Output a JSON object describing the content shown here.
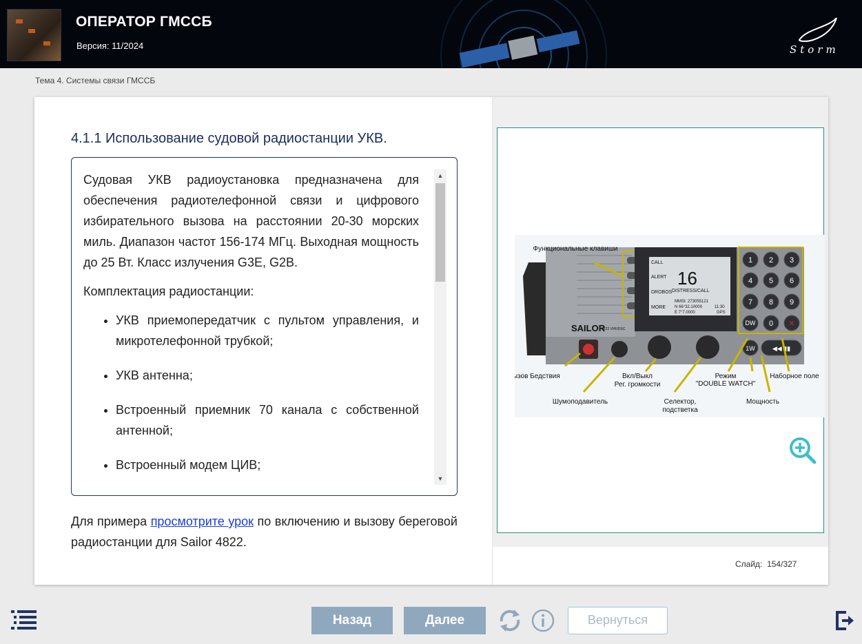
{
  "header": {
    "title": "ОПЕРАТОР ГМССБ",
    "version": "Версия: 11/2024",
    "logo_text": "Storm"
  },
  "breadcrumb": "Тема 4. Системы связи ГМССБ",
  "content": {
    "heading": "4.1.1 Использование судовой радиостанции УКВ.",
    "paragraph1": "Судовая УКВ радиоустановка предназначена для обеспечения радиотелефонной связи и цифрового избирательного вызова на расстоянии 20-30 морских миль. Диапазон частот 156-174 МГц. Выходная мощность до 25 Вт. Класс излучения G3E, G2B.",
    "paragraph2": "Комплектация радиостанции:",
    "list": [
      "УКВ приемопередатчик с пультом управления, и микротелефонной трубкой;",
      "УКВ антенна;",
      "Встроенный приемник 70 канала с собственной антенной;",
      "Встроенный модем ЦИВ;"
    ],
    "below_before": "Для примера ",
    "below_link": "просмотрите урок",
    "below_after": " по включению и вызову береговой радиостанции для Sailor 4822."
  },
  "figure": {
    "brand": "SAILOR",
    "model": "6222 VHF/DSC",
    "display": {
      "channel": "16",
      "mode": "DISTRESS/CALL",
      "soft_keys": [
        "CALL",
        "ALERT",
        "DROBOS",
        "MORE"
      ],
      "mmsi": "MMSI: 273055121",
      "lat": "N 66°32.10000",
      "lon": "E 7°7.0000",
      "time": "11:30",
      "gps": "GPS"
    },
    "labels": {
      "func_keys": "Функциональные клавиши",
      "distress": "Вызов Бедствия",
      "squelch": "Шумоподавитель",
      "onoff": "Вкл/Выкл",
      "volume": "Рег. громкости",
      "selector": "Селектор,",
      "backlight": "подстветка",
      "mode": "Режим",
      "double_watch": "\"DOUBLE WATCH\"",
      "keypad": "Наборное поле",
      "power": "Мощность"
    },
    "keys": [
      "1",
      "2",
      "3",
      "4",
      "5",
      "6",
      "7",
      "8",
      "9",
      "DW",
      "0",
      "✕",
      "1W"
    ],
    "accent": "#c8b400"
  },
  "slide": {
    "label": "Слайд:",
    "current": "154",
    "sep": "/",
    "total": "327"
  },
  "footer": {
    "back": "Назад",
    "next": "Далее",
    "return": "Вернуться"
  },
  "colors": {
    "accent": "#2c8c86",
    "heading": "#1a2d5a",
    "button": "#8fa8bd",
    "zoom": "#3fbfc9"
  }
}
